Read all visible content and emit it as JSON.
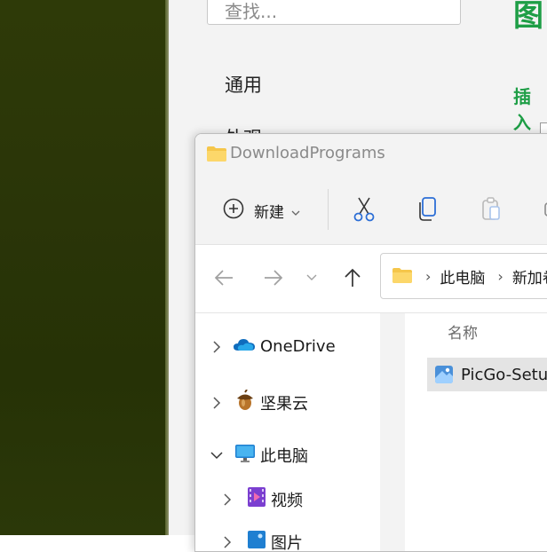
{
  "settings": {
    "search_placeholder": "查找...",
    "nav_general": "通用",
    "nav_next": "外观",
    "heading_big": "图",
    "heading_small": "插入"
  },
  "explorer": {
    "title": "DownloadPrograms",
    "toolbar": {
      "new_label": "新建"
    },
    "address": {
      "crumbs": [
        "此电脑",
        "新加卷"
      ]
    },
    "nav_pane": {
      "items": [
        {
          "label": "OneDrive",
          "icon": "onedrive-cloud-icon",
          "expanded": false
        },
        {
          "label": "坚果云",
          "icon": "acorn-icon",
          "expanded": false
        },
        {
          "label": "此电脑",
          "icon": "monitor-icon",
          "expanded": true
        },
        {
          "label": "视频",
          "icon": "video-folder-icon",
          "expanded": false
        },
        {
          "label": "图片",
          "icon": "pictures-folder-icon",
          "expanded": false
        }
      ]
    },
    "content": {
      "column_name": "名称",
      "files": [
        {
          "name": "PicGo-Setup",
          "icon": "installer-icon",
          "selected": true
        }
      ]
    }
  },
  "colors": {
    "accent_green": "#1e9e46",
    "desktop_green": "#2e3a08",
    "onedrive_blue": "#0f6cbd",
    "folder_yellow": "#f5c64a"
  }
}
